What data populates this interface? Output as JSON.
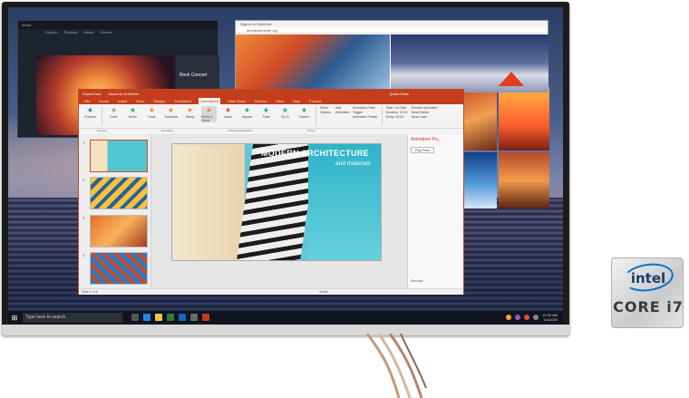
{
  "taskbar": {
    "search_placeholder": "Type here to search",
    "clock_time": "10:30 AM",
    "clock_date": "1/1/2020"
  },
  "media_window": {
    "title": "Music",
    "tabs": [
      "Explore",
      "Playlists",
      "Artists",
      "Genres"
    ],
    "side_label": "Rock Concert"
  },
  "browser": {
    "tab": "Sign in to OneDrive",
    "url": "architecturesite.org"
  },
  "powerpoint": {
    "title": "PowerPoint",
    "filename": "Saved to OneDrive",
    "user": "Quinn Dabe",
    "tabs": [
      "File",
      "Home",
      "Insert",
      "Draw",
      "Design",
      "Transitions",
      "Animations",
      "Slide Show",
      "Review",
      "View",
      "Help",
      "Format"
    ],
    "active_tab": "Animations",
    "ribbon_effects": [
      "Preview",
      "None",
      "Arrive",
      "Fade",
      "Turntable",
      "Swing",
      "Circle & Curve",
      "Lasso",
      "Appear",
      "Twist",
      "Fly In",
      "Float In"
    ],
    "ribbon_options": [
      "Effect Options",
      "Add Animation",
      "Animation Pane",
      "Trigger",
      "Animation Painter"
    ],
    "timing": [
      "Start: On Click",
      "Duration: 02.00",
      "Delay: 00.00",
      "Reorder Animation",
      "Move Earlier",
      "Move Later"
    ],
    "ribbon_groups": [
      "Preview",
      "Animation",
      "Advanced Animation",
      "Timing"
    ],
    "slide_title": "MODERN ARCHITECTURE",
    "slide_subtitle": "and materials",
    "thumb_numbers": [
      "1",
      "2",
      "3",
      "4"
    ],
    "anim_pane_title": "Animation Pa...",
    "anim_play": "Play From",
    "seconds_label": "Seconds",
    "status_slide": "Slide 1 of 5",
    "status_notes": "Notes"
  },
  "intel_badge": {
    "brand": "intel",
    "product": "CORE i7"
  },
  "colors": {
    "ppt_accent": "#c43e1c",
    "intel_blue": "#0c71c3"
  }
}
